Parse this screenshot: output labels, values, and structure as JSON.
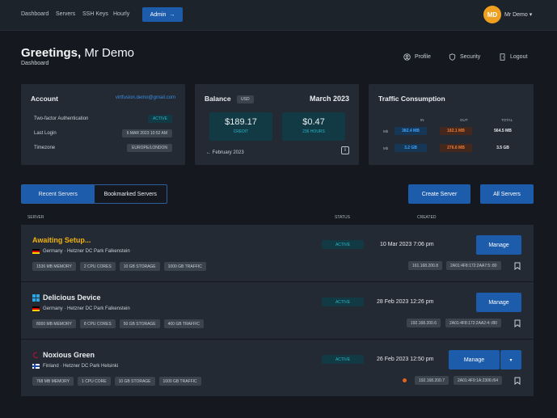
{
  "nav": {
    "links": [
      "Dashboard",
      "Servers",
      "SSH Keys",
      "Hourly"
    ],
    "admin_label": "Admin",
    "avatar_initials": "MD",
    "user_name": "Mr Demo"
  },
  "header": {
    "greeting": "Greetings,",
    "name": "Mr Demo",
    "subtitle": "Dashboard",
    "links": [
      "Profile",
      "Security",
      "Logout"
    ]
  },
  "account": {
    "title": "Account",
    "email": "virtfusion.demo@gmail.com",
    "rows": [
      {
        "label": "Two-factor Authentication",
        "value": "ACTIVE"
      },
      {
        "label": "Last Login",
        "value": "6 MAR 2023 10:52 AM"
      },
      {
        "label": "Timezone",
        "value": "EUROPE/LONDON"
      }
    ]
  },
  "balance": {
    "title": "Balance",
    "currency": "USD",
    "month": "March 2023",
    "credit_value": "$189.17",
    "credit_label": "CREDIT",
    "hours_value": "$0.47",
    "hours_label": "236 HOURS",
    "prev_month": "← February 2023"
  },
  "traffic": {
    "title": "Traffic Consumption",
    "headers": [
      "IN",
      "OUT",
      "TOTAL"
    ],
    "rows": [
      {
        "label": "Mb",
        "in": "382.4 MB",
        "out": "182.1 MB",
        "total": "564.5 MB"
      },
      {
        "label": "Mb",
        "in": "3.2 GB",
        "out": "276.6 MB",
        "total": "3.5 GB"
      }
    ]
  },
  "tabs": [
    "Recent Servers",
    "Bookmarked Servers"
  ],
  "actions": {
    "create": "Create Server",
    "all": "All Servers"
  },
  "columns": {
    "server": "SERVER",
    "status": "STATUS",
    "created": "CREATED"
  },
  "servers": [
    {
      "name": "Awaiting Setup...",
      "location": "Germany · Hetzner DC Park Falkenstein",
      "specs": [
        "1536 MB MEMORY",
        "2 CPU CORES",
        "10 GB STORAGE",
        "1000 GB TRAFFIC"
      ],
      "status": "ACTIVE",
      "created": "10 Mar 2023 7:06 pm",
      "manage": "Manage",
      "ipv4": "161.168.200.8",
      "ipv6": "2A01:4F8:172:2AA7:5::80"
    },
    {
      "name": "Delicious Device",
      "location": "Germany · Hetzner DC Park Falkenstein",
      "specs": [
        "8000 MB MEMORY",
        "8 CPU CORES",
        "50 GB STORAGE",
        "400 GB TRAFFIC"
      ],
      "status": "ACTIVE",
      "created": "28 Feb 2023 12:26 pm",
      "manage": "Manage",
      "ipv4": "192.168.200.6",
      "ipv6": "2A01:4F8:172:2AA2:4::/80"
    },
    {
      "name": "Noxious Green",
      "location": "Finland · Hetzner DC Park Helsinki",
      "specs": [
        "768 MB MEMORY",
        "1 CPU CORE",
        "10 GB STORAGE",
        "1000 GB TRAFFIC"
      ],
      "status": "ACTIVE",
      "created": "26 Feb 2023 12:50 pm",
      "manage": "Manage",
      "ipv4": "192.168.200.7",
      "ipv6": "2A01:4F9:1A:2306:/64"
    }
  ]
}
